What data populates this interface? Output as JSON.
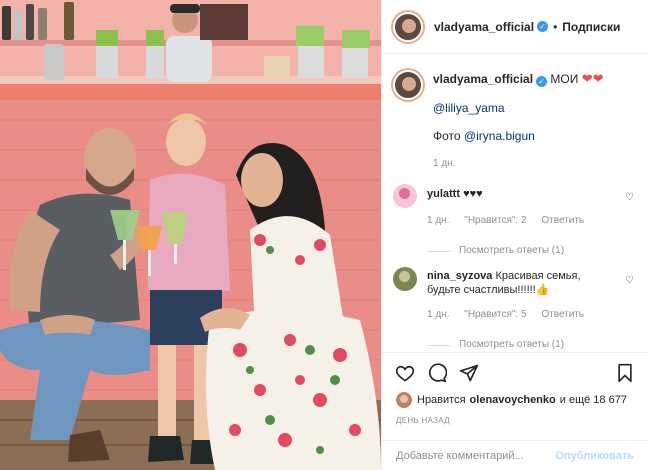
{
  "post": {
    "author": "vladyama_official",
    "follow_label": "Подписки",
    "caption": {
      "text": "МОИ",
      "mention1": "@liliya_yama",
      "photo_label": "Фото",
      "mention2": "@iryna.bigun",
      "time": "1 дн."
    },
    "comments": [
      {
        "user": "yulattt",
        "text": "♥♥♥",
        "time": "1 дн.",
        "likes": "\"Нравится\": 2",
        "reply": "Ответить",
        "view_replies": "Посмотреть ответы (1)"
      },
      {
        "user": "nina_syzova",
        "text": "Красивая семья, будьте счастливы!!!!!!👍",
        "time": "1 дн.",
        "likes": "\"Нравится\": 5",
        "reply": "Ответить",
        "view_replies": "Посмотреть ответы (1)"
      }
    ],
    "likes": {
      "prefix": "Нравится",
      "user": "olenavoychenko",
      "suffix": "и ещё 18 677"
    },
    "date": "ДЕНЬ НАЗАД",
    "add_comment_placeholder": "Добавьте комментарий...",
    "publish_label": "Опубликовать"
  },
  "icons": [
    "verified-badge-icon",
    "heart-icon",
    "comment-icon",
    "share-icon",
    "bookmark-icon",
    "chevron-heart-icon"
  ],
  "colors": {
    "verified": "#3897f0",
    "heart": "#ed4956",
    "link": "#00376b",
    "muted": "#8e8e8e",
    "publish_disabled": "#b3dbff"
  }
}
